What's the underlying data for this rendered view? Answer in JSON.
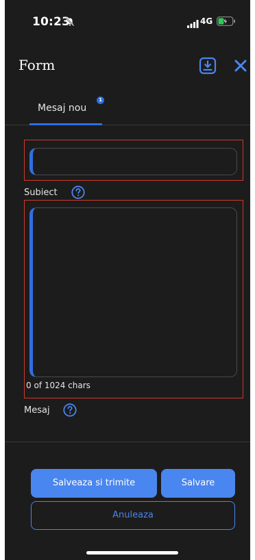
{
  "status_bar": {
    "time": "10:23",
    "network": "4G"
  },
  "header": {
    "title": "Form"
  },
  "tabs": [
    {
      "label": "Mesaj nou",
      "badge": "1"
    }
  ],
  "form": {
    "subject": {
      "value": "",
      "label": "Subiect"
    },
    "message": {
      "value": "",
      "char_counter": "0 of 1024 chars",
      "label": "Mesaj"
    }
  },
  "buttons": {
    "send_label": "Salveaza si trimite",
    "save_label": "Salvare",
    "cancel_label": "Anuleaza"
  },
  "colors": {
    "background": "#1c1c1c",
    "accent": "#4a86ef",
    "tab_accent": "#2f6fe0",
    "error_outline": "#d0392b"
  },
  "icons": {
    "bell": "bell-slash-icon",
    "signal": "signal-icon",
    "battery": "battery-charging-icon",
    "download": "download-icon",
    "close": "close-icon",
    "help": "help-icon"
  }
}
